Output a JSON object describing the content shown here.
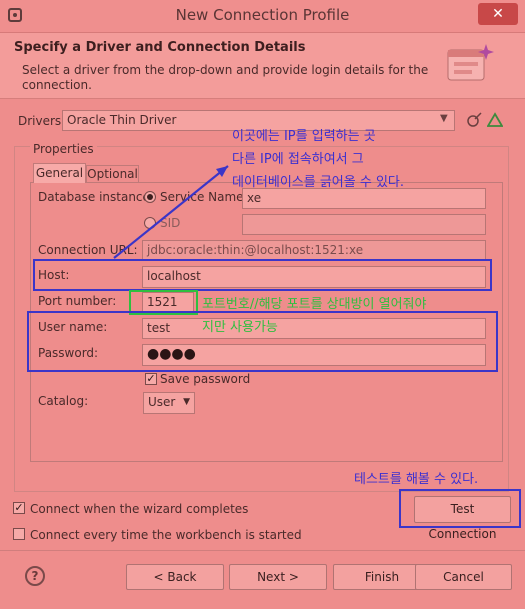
{
  "window": {
    "title": "New Connection Profile",
    "close": "✕"
  },
  "header": {
    "title": "Specify a Driver and Connection Details",
    "description": "Select a driver from the drop-down and provide login details for the connection."
  },
  "drivers": {
    "label": "Drivers:",
    "value": "Oracle Thin Driver"
  },
  "properties": {
    "label": "Properties",
    "tabs": [
      "General",
      "Optional"
    ],
    "db_instance_label": "Database instance:",
    "service_name_label": "Service Name",
    "service_name_value": "xe",
    "sid_label": "SID",
    "sid_value": "",
    "connection_url_label": "Connection URL:",
    "connection_url_value": "jdbc:oracle:thin:@localhost:1521:xe",
    "host_label": "Host:",
    "host_value": "localhost",
    "port_label": "Port number:",
    "port_value": "1521",
    "user_label": "User name:",
    "user_value": "test",
    "password_label": "Password:",
    "password_value": "●●●●",
    "save_password_label": "Save password",
    "catalog_label": "Catalog:",
    "catalog_value": "User"
  },
  "annotations": {
    "host_line1": "이곳에는 IP를 입력하는 곳",
    "host_line2": "다른 IP에 접속하여서 그",
    "host_line3": "데이터베이스를 긁어올 수 있다.",
    "port_line1": "포트번호//해당 포트를 상대방이 열어줘야",
    "port_line2": "지만 사용가능",
    "test_note": "테스트를 해볼 수 있다."
  },
  "options": {
    "connect_wizard": "Connect when the wizard completes",
    "connect_every": "Connect every time the workbench is started"
  },
  "buttons": {
    "test_connection": "Test Connection",
    "back": "< Back",
    "next": "Next >",
    "finish": "Finish",
    "cancel": "Cancel",
    "help": "?"
  },
  "colors": {
    "annotation_blue": "#3b35c8",
    "annotation_green": "#2fbf3f",
    "background": "#ee8d8c"
  }
}
